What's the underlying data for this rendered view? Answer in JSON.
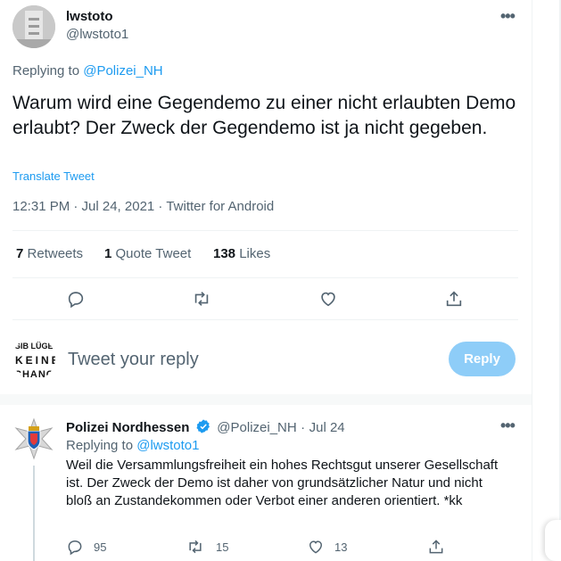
{
  "tweet": {
    "author_name": "lwstoto",
    "author_handle": "@lwstoto1",
    "replying_prefix": "Replying to",
    "replying_to": "@Polizei_NH",
    "text": "Warum wird eine Gegendemo zu einer nicht erlaubten Demo erlaubt? Der Zweck der Gegendemo ist ja nicht gegeben.",
    "translate": "Translate Tweet",
    "timestamp": "12:31 PM · Jul 24, 2021 · Twitter for Android",
    "stats": {
      "retweets_count": "7",
      "retweets_label": "Retweets",
      "quotes_count": "1",
      "quotes_label": "Quote Tweet",
      "likes_count": "138",
      "likes_label": "Likes"
    }
  },
  "compose": {
    "avatar_lines": [
      "GIB LÜGEN",
      "KEINE",
      "CHANCE"
    ],
    "placeholder": "Tweet your reply",
    "button": "Reply"
  },
  "reply": {
    "author_name": "Polizei Nordhessen",
    "author_handle": "@Polizei_NH",
    "dot": "·",
    "date": "Jul 24",
    "replying_prefix": "Replying to",
    "replying_to": "@lwstoto1",
    "text": "Weil die Versammlungsfreiheit ein hohes Rechtsgut unserer Gesellschaft ist. Der Zweck der Demo ist daher von grundsätzlicher Natur und nicht bloß an Zustandekommen oder Verbot einer anderen orientiert. *kk",
    "reply_count": "95",
    "retweet_count": "15",
    "like_count": "13"
  },
  "colors": {
    "accent": "#1d9bf0",
    "reply_button_disabled": "#8ecdf8",
    "muted_text": "#536471"
  },
  "icons": [
    "more-icon",
    "reply-icon",
    "retweet-icon",
    "like-icon",
    "share-icon",
    "verified-icon"
  ]
}
